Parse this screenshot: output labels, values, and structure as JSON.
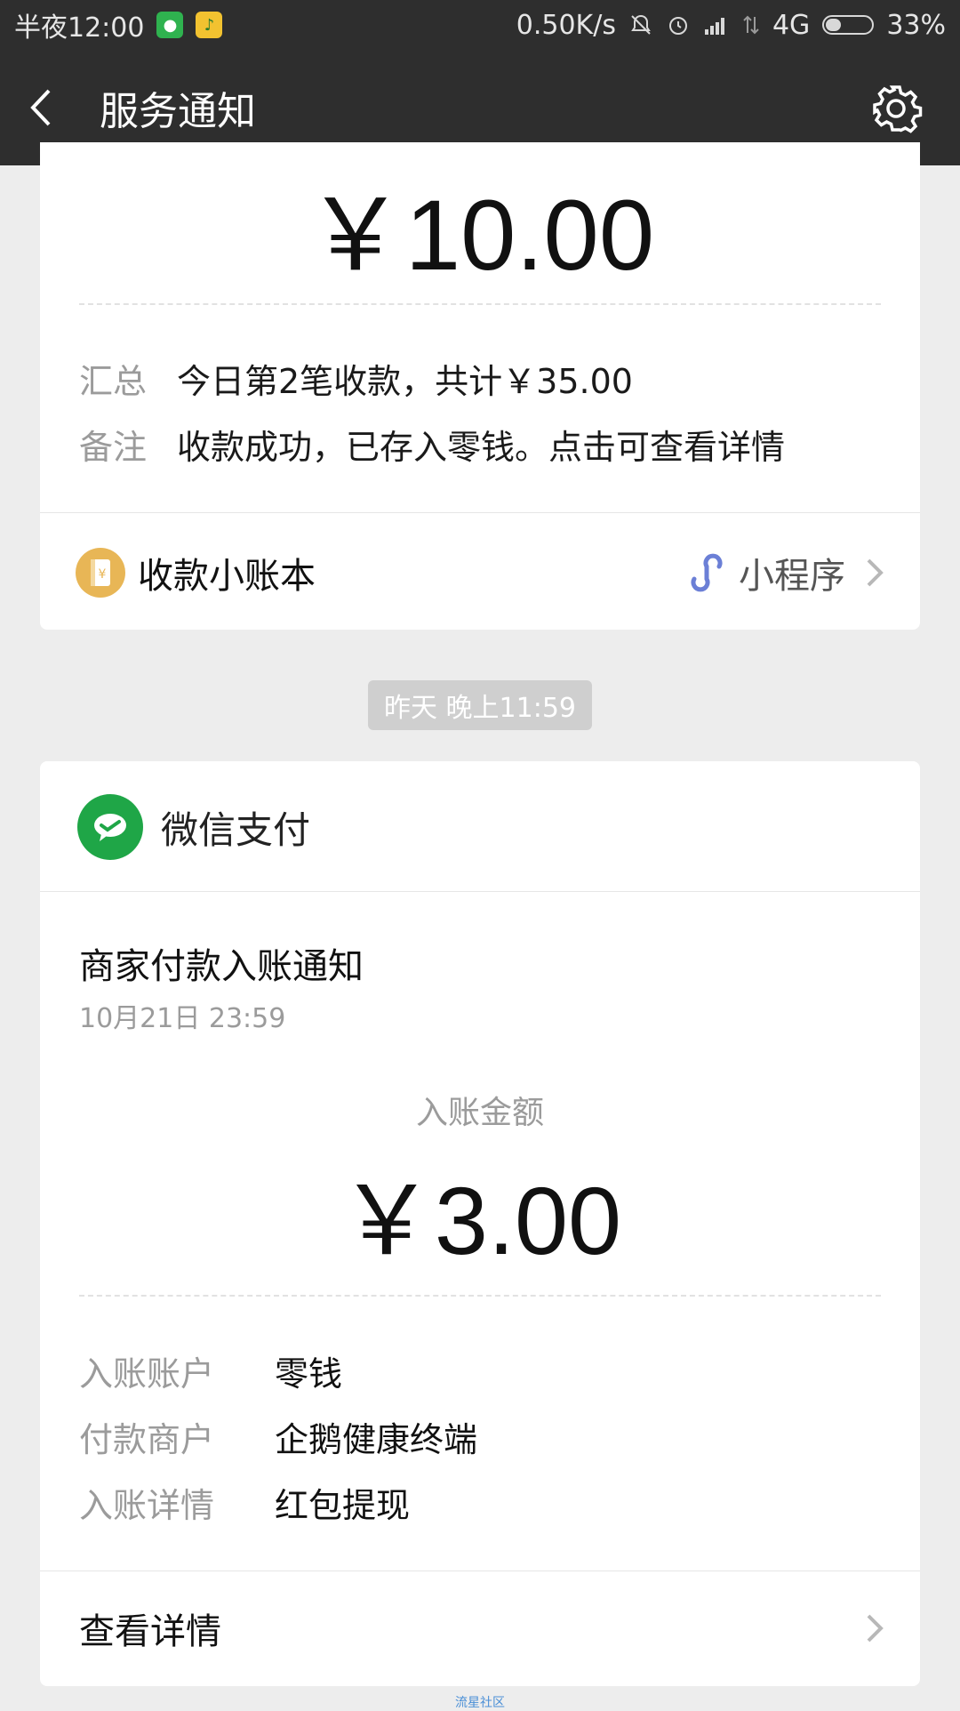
{
  "status_bar": {
    "time": "半夜12:00",
    "network_speed": "0.50K/s",
    "network_type": "4G",
    "battery": "33%",
    "battery_level": 0.33,
    "app_icons": [
      "wechat-app-icon",
      "qq-music-app-icon"
    ]
  },
  "nav": {
    "title": "服务通知",
    "back_icon": "chevron-left-icon",
    "settings_icon": "gear-icon"
  },
  "card1": {
    "amount": "￥10.00",
    "rows": [
      {
        "label": "汇总",
        "value": "今日第2笔收款，共计￥35.00"
      },
      {
        "label": "备注",
        "value": "收款成功，已存入零钱。点击可查看详情"
      }
    ],
    "ledger_label": "收款小账本",
    "mini_program_label": "小程序"
  },
  "timestamp": "昨天 晚上11:59",
  "card2": {
    "sender": "微信支付",
    "title": "商家付款入账通知",
    "time": "10月21日  23:59",
    "amount_label": "入账金额",
    "amount": "￥3.00",
    "details": [
      {
        "label": "入账账户",
        "value": "零钱"
      },
      {
        "label": "付款商户",
        "value": "企鹅健康终端"
      },
      {
        "label": "入账详情",
        "value": "红包提现"
      }
    ],
    "view_detail": "查看详情"
  },
  "watermark": "流星社区",
  "colors": {
    "bar_bg": "#2e2e2e",
    "page_bg": "#ededed",
    "wechat_green": "#1fa647",
    "ledger_gold": "#e8b656",
    "mini_program_blue": "#6b7fd6"
  }
}
